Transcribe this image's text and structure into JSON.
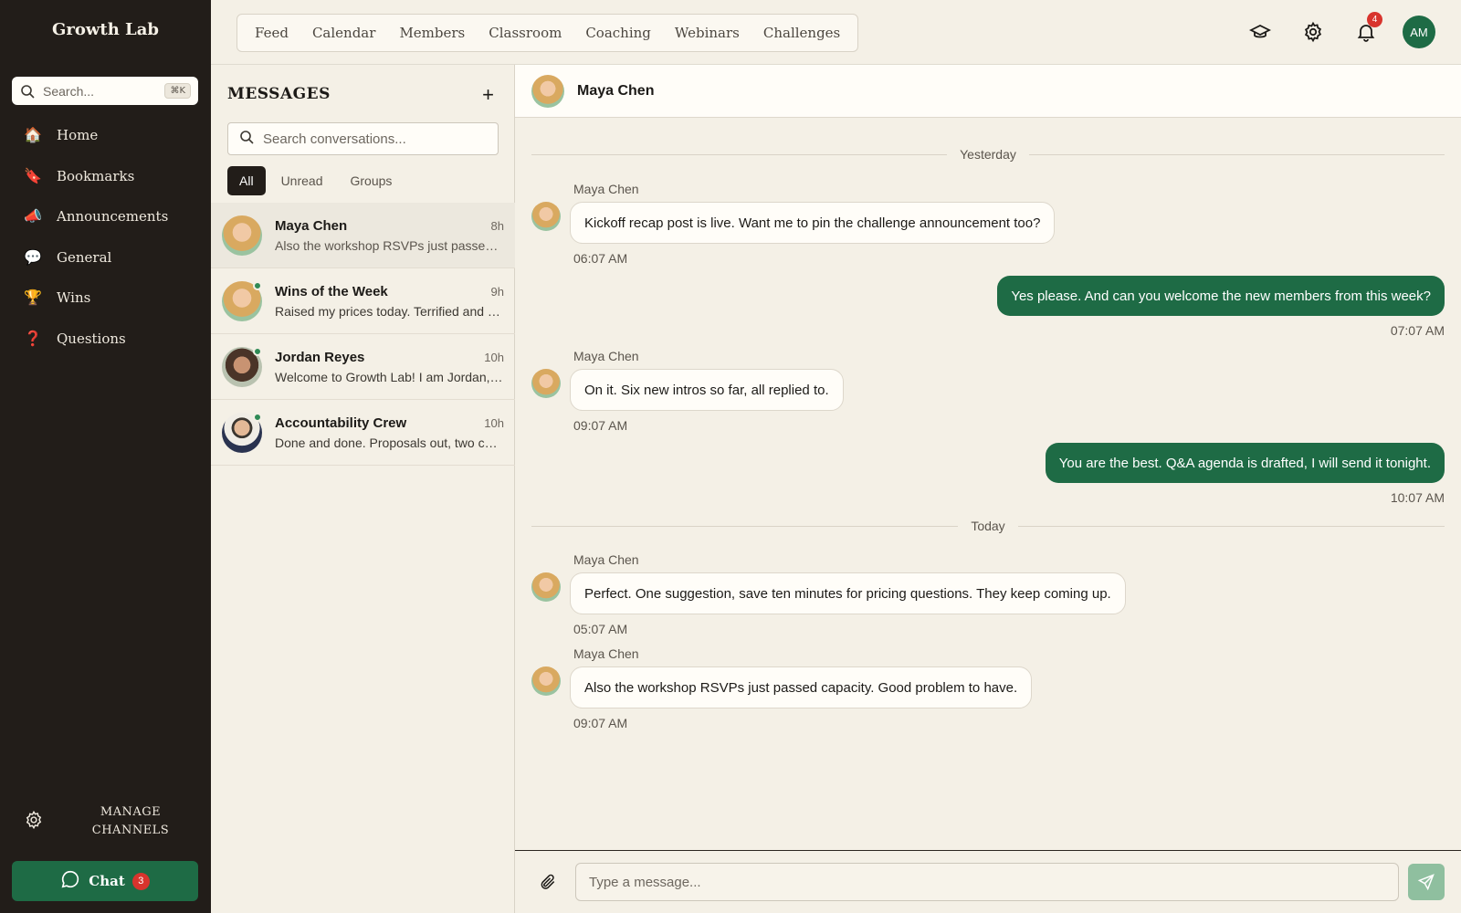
{
  "brand": "Growth Lab",
  "sidebar": {
    "search_placeholder": "Search...",
    "search_shortcut": "⌘K",
    "items": [
      {
        "emoji": "🏠",
        "label": "Home"
      },
      {
        "emoji": "🔖",
        "label": "Bookmarks"
      },
      {
        "emoji": "📣",
        "label": "Announcements"
      },
      {
        "emoji": "💬",
        "label": "General"
      },
      {
        "emoji": "🏆",
        "label": "Wins"
      },
      {
        "emoji": "❓",
        "label": "Questions"
      }
    ],
    "manage_label": "MANAGE CHANNELS",
    "chat_label": "Chat",
    "chat_count": "3"
  },
  "topbar": {
    "tabs": [
      "Feed",
      "Calendar",
      "Members",
      "Classroom",
      "Coaching",
      "Webinars",
      "Challenges"
    ],
    "notification_count": "4",
    "user_initials": "AM"
  },
  "messages_panel": {
    "title": "MESSAGES",
    "new_button": "+",
    "search_placeholder": "Search conversations...",
    "filters": [
      "All",
      "Unread",
      "Groups"
    ],
    "active_filter": "All",
    "conversations": [
      {
        "name": "Maya Chen",
        "time": "8h",
        "preview": "Also the workshop RSVPs just passed capacity. Good problem to have.",
        "online": false,
        "active": true
      },
      {
        "name": "Wins of the Week",
        "time": "9h",
        "preview": "Raised my prices today. Terrified and excited.",
        "online": true,
        "active": false
      },
      {
        "name": "Jordan Reyes",
        "time": "10h",
        "preview": "Welcome to Growth Lab! I am Jordan, happy to help.",
        "online": true,
        "active": false
      },
      {
        "name": "Accountability Crew",
        "time": "10h",
        "preview": "Done and done. Proposals out, two calls booked.",
        "online": true,
        "active": false
      }
    ]
  },
  "chat": {
    "contact_name": "Maya Chen",
    "day_yesterday": "Yesterday",
    "day_today": "Today",
    "messages": [
      {
        "direction": "in",
        "sender": "Maya Chen",
        "text": "Kickoff recap post is live. Want me to pin the challenge announcement too?",
        "time": "06:07 AM"
      },
      {
        "direction": "out",
        "text": "Yes please. And can you welcome the new members from this week?",
        "time": "07:07 AM"
      },
      {
        "direction": "in",
        "sender": "Maya Chen",
        "text": "On it. Six new intros so far, all replied to.",
        "time": "09:07 AM"
      },
      {
        "direction": "out",
        "text": "You are the best. Q&A agenda is drafted, I will send it tonight.",
        "time": "10:07 AM"
      },
      {
        "direction": "in",
        "sender": "Maya Chen",
        "text": "Perfect. One suggestion, save ten minutes for pricing questions. They keep coming up.",
        "time": "05:07 AM"
      },
      {
        "direction": "in",
        "sender": "Maya Chen",
        "text": "Also the workshop RSVPs just passed capacity. Good problem to have.",
        "time": "09:07 AM"
      }
    ],
    "input_placeholder": "Type a message..."
  },
  "colors": {
    "sidebar_bg": "#221d19",
    "accent_green": "#1e6b45",
    "badge_red": "#d8342d",
    "page_bg": "#f4f0e6"
  },
  "icons": {
    "search": "search-icon",
    "graduation": "graduation-cap-icon",
    "settings": "gear-icon",
    "notifications": "bell-icon",
    "attach": "paperclip-icon",
    "send": "send-icon",
    "chat": "chat-bubble-icon"
  }
}
